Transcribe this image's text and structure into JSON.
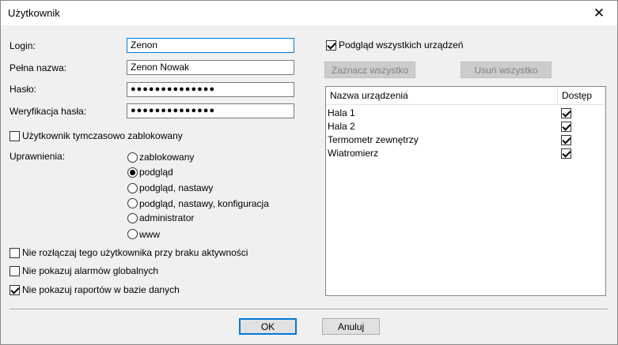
{
  "window": {
    "title": "Użytkownik",
    "close_glyph": "✕"
  },
  "form": {
    "login_label": "Login:",
    "login_value": "Zenon",
    "fullname_label": "Pełna nazwa:",
    "fullname_value": "Zenon Nowak",
    "password_label": "Hasło:",
    "password_value": "●●●●●●●●●●●●●●",
    "password_confirm_label": "Weryfikacja hasła:",
    "password_confirm_value": "●●●●●●●●●●●●●●",
    "temp_blocked_label": "Użytkownik tymczasowo zablokowany",
    "temp_blocked_checked": false,
    "permissions_label": "Uprawnienia:",
    "permissions": [
      {
        "label": "zablokowany",
        "selected": false
      },
      {
        "label": "podgląd",
        "selected": true
      },
      {
        "label": "podgląd, nastawy",
        "selected": false
      },
      {
        "label": "podgląd, nastawy, konfiguracja",
        "selected": false
      },
      {
        "label": "administrator",
        "selected": false
      },
      {
        "label": "www",
        "selected": false
      }
    ],
    "no_disconnect_label": "Nie rozłączaj tego użytkownika przy braku aktywności",
    "no_disconnect_checked": false,
    "no_global_alarms_label": "Nie pokazuj alarmów globalnych",
    "no_global_alarms_checked": false,
    "no_reports_label": "Nie pokazuj raportów w bazie danych",
    "no_reports_checked": true
  },
  "devices": {
    "preview_all_label": "Podgląd wszystkich urządzeń",
    "preview_all_checked": true,
    "select_all_label": "Zaznacz wszystko",
    "remove_all_label": "Usuń wszystko",
    "col_name": "Nazwa urządzenia",
    "col_access": "Dostęp",
    "sort_glyph": "∕",
    "rows": [
      {
        "name": "Hala 1",
        "access": true
      },
      {
        "name": "Hala 2",
        "access": true
      },
      {
        "name": "Termometr zewnętrzy",
        "access": true
      },
      {
        "name": "Wiatromierz",
        "access": true
      }
    ]
  },
  "buttons": {
    "ok": "OK",
    "cancel": "Anuluj"
  }
}
